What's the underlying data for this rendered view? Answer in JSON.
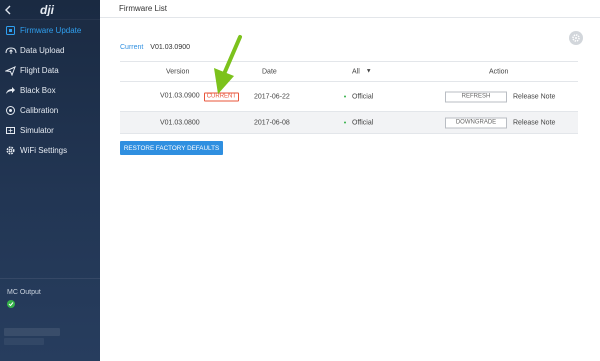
{
  "colors": {
    "accent": "#2f8fe0",
    "sidebar_bg": "#1f324e",
    "badge": "#e8543a",
    "status_ok": "#36b24a",
    "annotation_arrow": "#7cc21c"
  },
  "sidebar": {
    "back_icon": "chevron-left-icon",
    "logo": "dji",
    "items": [
      {
        "label": "Firmware Update",
        "icon": "firmware-icon",
        "active": true
      },
      {
        "label": "Data Upload",
        "icon": "data-upload-icon"
      },
      {
        "label": "Flight Data",
        "icon": "plane-icon"
      },
      {
        "label": "Black Box",
        "icon": "share-arrow-icon"
      },
      {
        "label": "Calibration",
        "icon": "calibration-icon"
      },
      {
        "label": "Simulator",
        "icon": "simulator-icon"
      },
      {
        "label": "WiFi Settings",
        "icon": "gear-icon"
      }
    ],
    "mc_output_label": "MC Output"
  },
  "main": {
    "title": "Firmware List",
    "current_label": "Current",
    "current_value": "V01.03.0900",
    "table": {
      "headers": {
        "version": "Version",
        "date": "Date",
        "filter": "All",
        "action": "Action"
      },
      "rows": [
        {
          "version": "V01.03.0900",
          "badge": "CURRENT",
          "date": "2017-06-22",
          "status": "Official",
          "action": "REFRESH",
          "note": "Release Note"
        },
        {
          "version": "V01.03.0800",
          "date": "2017-06-08",
          "status": "Official",
          "action": "DOWNGRADE",
          "note": "Release Note"
        }
      ]
    },
    "restore_label": "RESTORE FACTORY DEFAULTS"
  }
}
